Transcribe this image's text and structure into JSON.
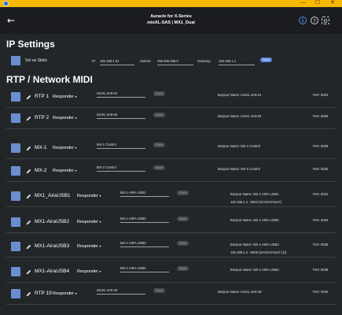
{
  "window": {
    "minimize": "—",
    "maximize": "☐",
    "close": "✕"
  },
  "header": {
    "title_line1": "Auracle for X-Series",
    "title_line2": "mioXL-SAS | MX1_Dual",
    "back": "←"
  },
  "ip_settings": {
    "title": "IP Settings",
    "static_label": "Set as Static",
    "ip_label": "IP:",
    "ip_value": "192.168.1.31",
    "subnet_label": "Subnet:",
    "subnet_value": "255.255.255.0",
    "gateway_label": "Gateway:",
    "gateway_value": "192.168.1.1",
    "save_label": "Save"
  },
  "rtp": {
    "title": "RTP / Network MIDI",
    "rows": [
      {
        "name": "RTP 1",
        "mode": "Responder",
        "session": "mioXL 3A9-01",
        "save": "Save",
        "bonjour": "Bonjour Name: mioXL 3A9-01",
        "port": "Port: 5004",
        "extra": ""
      },
      {
        "name": "RTP 2",
        "mode": "Responder",
        "session": "mioXL 3A9-02",
        "save": "Save",
        "bonjour": "Bonjour Name: mioXL 3A9-02",
        "port": "Port: 5006",
        "extra": ""
      },
      {
        "name": "MX-1",
        "mode": "Responder",
        "session": "MX-1 Control",
        "save": "Save",
        "bonjour": "Bonjour Name: MX-1 Control",
        "port": "Port: 5028",
        "extra": ""
      },
      {
        "name": "MX-2",
        "mode": "Responder",
        "session": "MX-2 Control",
        "save": "Save",
        "bonjour": "Bonjour Name: MX-2 Control",
        "port": "Port: 5030",
        "extra": ""
      },
      {
        "name": "MX1_AiraUSB1",
        "mode": "Responder",
        "session": "MX-1 AIRA USB1",
        "save": "Save",
        "bonjour": "Bonjour Name: MX-1 AIRA USB1",
        "port": "Port: 5022",
        "extra": "192.168.1.4 : 5004 (SASCHANUC)"
      },
      {
        "name": "MX1-AiraUSB2",
        "mode": "Responder",
        "session": "MX-1 AIRA USB2",
        "save": "Save",
        "bonjour": "Bonjour Name: MX-1 AIRA USB2",
        "port": "Port: 5034",
        "extra": ""
      },
      {
        "name": "MX1-AiraUSB3",
        "mode": "Responder",
        "session": "MX-1 AIRA USB3",
        "save": "Save",
        "bonjour": "Bonjour Name: MX-1 AIRA USB3",
        "port": "Port: 5036",
        "extra": "192.168.1.4 : 5006 (SASCHANUC (1))"
      },
      {
        "name": "MX1-AiraUSB4",
        "mode": "Responder",
        "session": "MX-1 AIRA USB4",
        "save": "Save",
        "bonjour": "Bonjour Name: MX-1 AIRA USB4",
        "port": "Port: 5038",
        "extra": ""
      },
      {
        "name": "RTP 19",
        "mode": "Responder",
        "session": "mioXL 3A9-19",
        "save": "Save",
        "bonjour": "Bonjour Name: mioXL 3A9-19",
        "port": "Port: 5040",
        "extra": ""
      }
    ]
  },
  "icons": {
    "info": "info-icon",
    "help": "help-icon",
    "settings": "gear-icon",
    "back": "back-arrow-icon",
    "edit": "pencil-icon"
  },
  "colors": {
    "titlebar": "#f6b800",
    "accent": "#5b8ce0",
    "checkbox": "#6a8fd0",
    "background": "#232629"
  }
}
